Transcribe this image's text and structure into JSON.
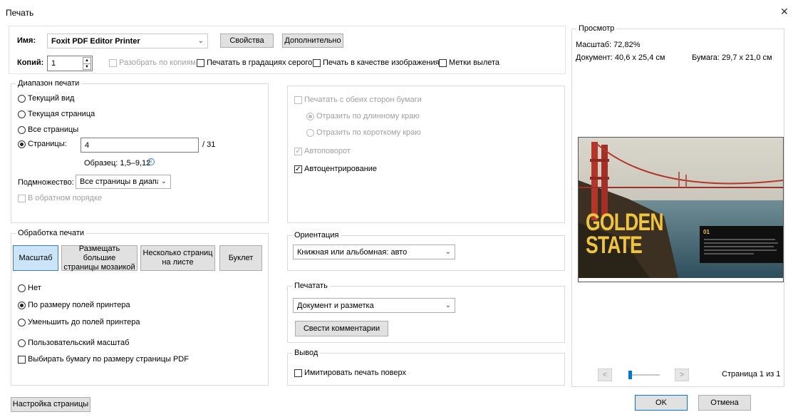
{
  "window": {
    "title": "Печать",
    "close_glyph": "✕"
  },
  "printer": {
    "name_label": "Имя:",
    "name_value": "Foxit PDF Editor Printer",
    "properties_button": "Свойства",
    "advanced_button": "Дополнительно",
    "copies_label": "Копий:",
    "copies_value": "1",
    "collate": "Разобрать по копиям",
    "grayscale": "Печатать в градациях серого",
    "as_image": "Печать в качестве изображения",
    "bleed_marks": "Метки вылета"
  },
  "print_range": {
    "title": "Диапазон печати",
    "current_view": "Текущий вид",
    "current_page": "Текущая страница",
    "all_pages": "Все страницы",
    "pages_label": "Страницы:",
    "pages_value": "4",
    "pages_total": "/ 31",
    "sample": "Образец: 1,5–9,12",
    "subset_label": "Подмножество:",
    "subset_value": "Все страницы в диапазс",
    "reverse": "В обратном порядке"
  },
  "duplex": {
    "both_sides": "Печатать с обеих сторон бумаги",
    "long_edge": "Отразить по длинному краю",
    "short_edge": "Отразить по короткому краю",
    "auto_rotate": "Автоповорот",
    "auto_center": "Автоцентрирование"
  },
  "handling": {
    "title": "Обработка печати",
    "tab_scale": "Масштаб",
    "tab_tile_line1": "Размещать большие",
    "tab_tile_line2": "страницы мозаикой",
    "tab_multiple_line1": "Несколько страниц",
    "tab_multiple_line2": "на листе",
    "tab_booklet": "Буклет",
    "none": "Нет",
    "fit_margins": "По размеру полей принтера",
    "shrink": "Уменьшить до полей принтера",
    "custom": "Пользовательский масштаб",
    "choose_paper": "Выбирать бумагу по размеру страницы PDF"
  },
  "orientation": {
    "title": "Ориентация",
    "value": "Книжная или альбомная: авто"
  },
  "print_what": {
    "title": "Печатать",
    "value": "Документ и разметка",
    "summarize_button": "Свести комментарии"
  },
  "output": {
    "title": "Вывод",
    "simulate_overprint": "Имитировать печать поверх"
  },
  "preview": {
    "title": "Просмотр",
    "scale": "Масштаб:  72,82%",
    "document": "Документ:  40,6 x 25,4 см",
    "paper": "Бумага:  29,7 x 21,0 см",
    "golden": "GOLDEN",
    "state": "STATE",
    "side_heading": "01",
    "page_label": "Страница 1 из 1",
    "prev_glyph": "<",
    "next_glyph": ">"
  },
  "footer": {
    "page_setup": "Настройка страницы",
    "ok": "OK",
    "cancel": "Отмена"
  }
}
